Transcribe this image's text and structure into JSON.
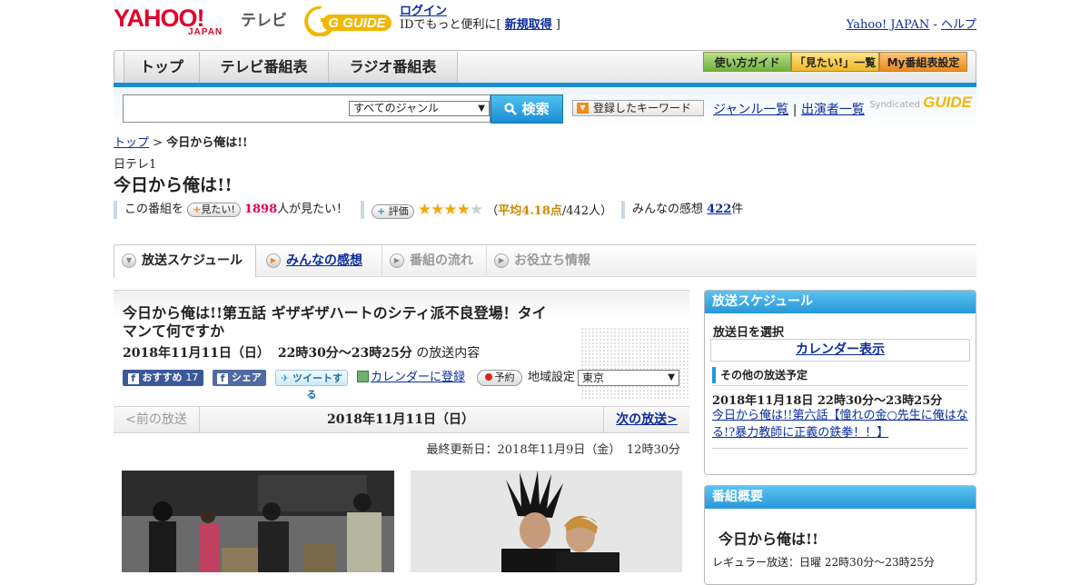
{
  "header": {
    "logo_text": "YAHOO!",
    "logo_sub": "JAPAN",
    "tv_label": "テレビ",
    "gguide_logo": "G GUIDE",
    "login_link": "ログイン",
    "login_note_pre": "IDでもっと便利に[ ",
    "register_link": "新規取得",
    "login_note_post": " ]",
    "yahoo_link": "Yahoo! JAPAN",
    "sep": " - ",
    "help_link": "ヘルプ"
  },
  "nav": {
    "tabs": [
      "トップ",
      "テレビ番組表",
      "ラジオ番組表"
    ],
    "buttons": [
      "使い方ガイド",
      "「見たい!」一覧",
      "My番組表設定"
    ]
  },
  "search": {
    "genre_selected": "すべてのジャンル",
    "search_button": "検索",
    "keyword_button": "登録したキーワード",
    "genre_list_link": "ジャンル一覧",
    "divider": "|",
    "cast_list_link": "出演者一覧",
    "syndicated_label": "Syndicated",
    "syndicated_logo": "GUIDE"
  },
  "breadcrumb": {
    "top": "トップ",
    "sep": " > ",
    "current": "今日から俺は!!"
  },
  "program": {
    "channel": "日テレ1",
    "title": "今日から俺は!!",
    "want_prefix": "この番組を",
    "want_button": "見たい!",
    "want_count": "1898",
    "want_suffix": "人が見たい！",
    "rate_button": "評価",
    "stars": 4.18,
    "rating_open": "（",
    "rating_label": "平均4.18点",
    "rating_count": "/442人）",
    "impressions_label": "みんなの感想",
    "impressions_count": "422",
    "impressions_unit": "件"
  },
  "subtabs": [
    {
      "label": "放送スケジュール",
      "state": "active"
    },
    {
      "label": "みんなの感想",
      "state": "link"
    },
    {
      "label": "番組の流れ",
      "state": "disabled"
    },
    {
      "label": "お役立ち情報",
      "state": "disabled"
    }
  ],
  "episode": {
    "title": "今日から俺は!!第五話 ギザギザハートのシティ派不良登場！タイマンて何ですか",
    "date": "2018年11月11日（日）",
    "time": "22時30分～23時25分",
    "date_suffix": "の放送内容",
    "fb_recommend": "おすすめ",
    "fb_recommend_count": "17",
    "fb_share": "シェア",
    "tweet": "ツイートする",
    "calendar_register": "カレンダーに登録",
    "reserve": "予約",
    "region_label": "地域設定",
    "region_selected": "東京"
  },
  "pager": {
    "prev": "<前の放送",
    "current": "2018年11月11日（日）",
    "next": "次の放送>"
  },
  "updated": "最終更新日：2018年11月9日（金）　12時30分",
  "sidebar": {
    "schedule_header": "放送スケジュール",
    "select_date_label": "放送日を選択",
    "calendar_button": "カレンダー表示",
    "other_label": "その他の放送予定",
    "other_date": "2018年11月18日  22時30分～23時25分",
    "other_title": "今日から俺は!!第六話【憧れの金○先生に俺はなる!?暴力教師に正義の鉄拳！！】",
    "overview_header": "番組概要",
    "overview_title": "今日から俺は!!",
    "overview_regular": "レギュラー放送：日曜 22時30分～23時25分"
  },
  "colors": {
    "accent_blue": "#1a8ed4",
    "yahoo_red": "#e0002a",
    "star_gold": "#f4a800"
  }
}
